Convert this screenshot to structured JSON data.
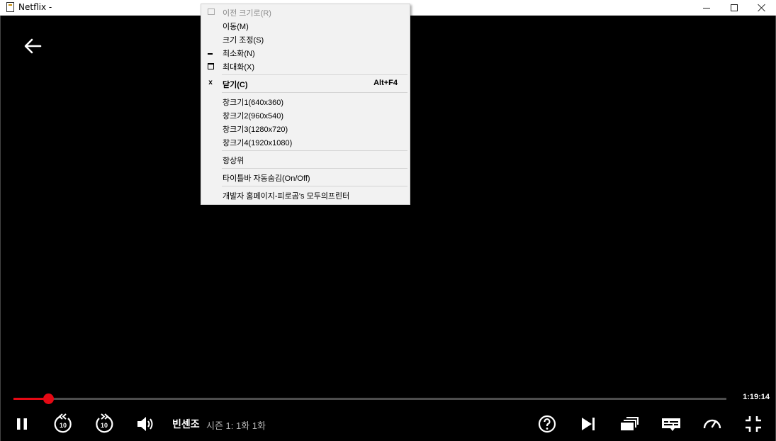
{
  "window": {
    "title": "Netflix -"
  },
  "player": {
    "elapsed_fraction": 0.049,
    "time_remaining": "1:19:14",
    "show_title": "빈센조",
    "episode_info": "시즌 1: 1화  1화",
    "accent_color": "#e50914",
    "icons": [
      "back-arrow-icon",
      "pause-icon",
      "rewind-10-icon",
      "forward-10-icon",
      "volume-icon",
      "help-icon",
      "next-episode-icon",
      "episodes-icon",
      "subtitles-icon",
      "speed-icon",
      "exit-fullscreen-icon"
    ]
  },
  "menu": {
    "items": [
      {
        "label": "이전 크기로(R)",
        "disabled": true,
        "icon": "restore-icon"
      },
      {
        "label": "이동(M)"
      },
      {
        "label": "크기 조정(S)"
      },
      {
        "label": "최소화(N)",
        "icon": "minimize-icon"
      },
      {
        "label": "최대화(X)",
        "icon": "maximize-icon"
      },
      {
        "label": "닫기(C)",
        "shortcut": "Alt+F4",
        "icon": "close-icon",
        "bold": true
      },
      {
        "label": "창크기1(640x360)"
      },
      {
        "label": "창크기2(960x540)"
      },
      {
        "label": "창크기3(1280x720)"
      },
      {
        "label": "창크기4(1920x1080)"
      },
      {
        "label": "항상위"
      },
      {
        "label": "타이틀바 자동숨김(On/Off)"
      },
      {
        "label": "개발자 홈페이지-피로곰's 모두의프린터"
      }
    ],
    "close_icon_glyph": "x"
  }
}
